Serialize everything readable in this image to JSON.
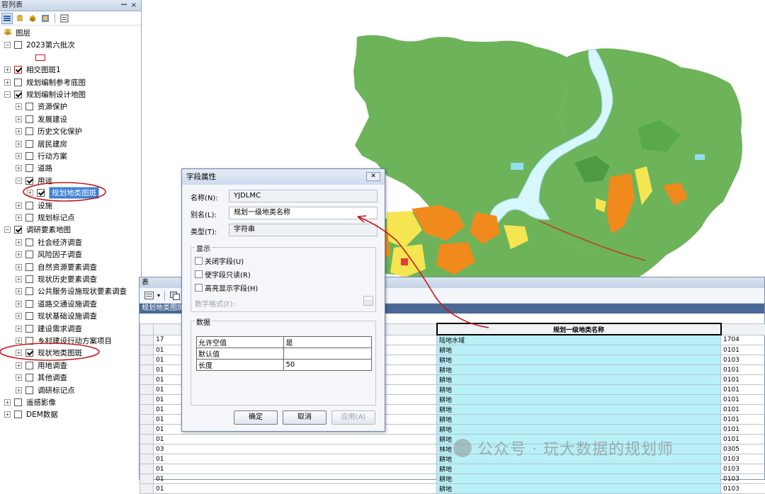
{
  "toc": {
    "title": "容列表",
    "pin": "ꟷ",
    "close": "×",
    "items": [
      {
        "label": "图层",
        "indent": 0,
        "exp": "",
        "chk": "",
        "icon": "layers"
      },
      {
        "label": "2023第六批次",
        "indent": 1,
        "exp": "−",
        "chk": "off"
      },
      {
        "label": "",
        "indent": 2,
        "exp": "",
        "chk": "",
        "icon": "red-rect"
      },
      {
        "label": "相交图斑1",
        "indent": 1,
        "exp": "+",
        "chk": "on-red"
      },
      {
        "label": "规划编制参考底图",
        "indent": 1,
        "exp": "+",
        "chk": "off"
      },
      {
        "label": "规划编制设计地图",
        "indent": 1,
        "exp": "−",
        "chk": "on"
      },
      {
        "label": "资源保护",
        "indent": 2,
        "exp": "+",
        "chk": "off"
      },
      {
        "label": "发展建设",
        "indent": 2,
        "exp": "+",
        "chk": "off"
      },
      {
        "label": "历史文化保护",
        "indent": 2,
        "exp": "+",
        "chk": "off"
      },
      {
        "label": "居民建房",
        "indent": 2,
        "exp": "+",
        "chk": "off"
      },
      {
        "label": "行动方案",
        "indent": 2,
        "exp": "+",
        "chk": "off"
      },
      {
        "label": "道路",
        "indent": 2,
        "exp": "+",
        "chk": "off"
      },
      {
        "label": "用途",
        "indent": 2,
        "exp": "−",
        "chk": "on"
      },
      {
        "label": "规划地类图斑",
        "indent": 3,
        "exp": "+",
        "chk": "on",
        "hl": true
      },
      {
        "label": "设施",
        "indent": 2,
        "exp": "+",
        "chk": "off"
      },
      {
        "label": "规划标记点",
        "indent": 2,
        "exp": "+",
        "chk": "off"
      },
      {
        "label": "调研要素地图",
        "indent": 1,
        "exp": "−",
        "chk": "on"
      },
      {
        "label": "社会经济调查",
        "indent": 2,
        "exp": "+",
        "chk": "off"
      },
      {
        "label": "风险因子调查",
        "indent": 2,
        "exp": "+",
        "chk": "off"
      },
      {
        "label": "自然资源要素调查",
        "indent": 2,
        "exp": "+",
        "chk": "off"
      },
      {
        "label": "现状历史要素调查",
        "indent": 2,
        "exp": "+",
        "chk": "off"
      },
      {
        "label": "公共服务设施现状要素调查",
        "indent": 2,
        "exp": "+",
        "chk": "off"
      },
      {
        "label": "道路交通设施调查",
        "indent": 2,
        "exp": "+",
        "chk": "off"
      },
      {
        "label": "现状基础设施调查",
        "indent": 2,
        "exp": "+",
        "chk": "off"
      },
      {
        "label": "建设需求调查",
        "indent": 2,
        "exp": "+",
        "chk": "off"
      },
      {
        "label": "乡村建设行动方案项目",
        "indent": 2,
        "exp": "+",
        "chk": "off"
      },
      {
        "label": "现状地类图斑",
        "indent": 2,
        "exp": "+",
        "chk": "on"
      },
      {
        "label": "用地调查",
        "indent": 2,
        "exp": "+",
        "chk": "off"
      },
      {
        "label": "其他调查",
        "indent": 2,
        "exp": "+",
        "chk": "off"
      },
      {
        "label": "调研标记点",
        "indent": 2,
        "exp": "+",
        "chk": "off"
      },
      {
        "label": "遥感影像",
        "indent": 1,
        "exp": "+",
        "chk": "off"
      },
      {
        "label": "DEM数据",
        "indent": 1,
        "exp": "+",
        "chk": "off"
      }
    ]
  },
  "table_window": {
    "title": "表",
    "tab_name": "规划地类图斑",
    "selected_header": "规划一级地类名称",
    "rows": [
      {
        "c1": "17",
        "name": "陆地水域",
        "code": "1704"
      },
      {
        "c1": "01",
        "name": "耕地",
        "code": "0101"
      },
      {
        "c1": "01",
        "name": "耕地",
        "code": "0103"
      },
      {
        "c1": "01",
        "name": "耕地",
        "code": "0101"
      },
      {
        "c1": "01",
        "name": "耕地",
        "code": "0101"
      },
      {
        "c1": "01",
        "name": "耕地",
        "code": "0101"
      },
      {
        "c1": "01",
        "name": "耕地",
        "code": "0101"
      },
      {
        "c1": "01",
        "name": "耕地",
        "code": "0101"
      },
      {
        "c1": "01",
        "name": "耕地",
        "code": "0101"
      },
      {
        "c1": "01",
        "name": "耕地",
        "code": "0101"
      },
      {
        "c1": "01",
        "name": "耕地",
        "code": "0101"
      },
      {
        "c1": "03",
        "name": "林地",
        "code": "0305"
      },
      {
        "c1": "01",
        "name": "耕地",
        "code": "0103"
      },
      {
        "c1": "01",
        "name": "耕地",
        "code": "0103"
      },
      {
        "c1": "01",
        "name": "耕地",
        "code": "0103"
      },
      {
        "c1": "01",
        "name": "耕地",
        "code": "0103"
      }
    ]
  },
  "dialog": {
    "title": "字段属性",
    "close": "✕",
    "name_label": "名称(N):",
    "name_value": "YJDLMC",
    "alias_label": "别名(L):",
    "alias_value": "规划一级地类名称",
    "type_label": "类型(T):",
    "type_value": "字符串",
    "display_group": "显示",
    "cb_off_field": "关闭字段(U)",
    "cb_readonly": "使字段只读(R)",
    "cb_highlight": "高亮显示字段(H)",
    "number_format": "数字格式(F):",
    "ellipsis": "...",
    "data_group": "数据",
    "props": [
      {
        "k": "允许空值",
        "v": "是"
      },
      {
        "k": "默认值",
        "v": ""
      },
      {
        "k": "长度",
        "v": "50"
      }
    ],
    "ok": "确定",
    "cancel": "取消",
    "apply": "应用(A)"
  },
  "watermark": "公众号 · 玩大数据的规划师",
  "colors": {
    "land_green": "#6db35a",
    "dark_green": "#3f8a35",
    "water": "#aee8f0",
    "orange": "#f08a1c",
    "yellow": "#f5e651",
    "annot_red": "#c51a1a",
    "cyan_col": "#b8f0f7"
  }
}
